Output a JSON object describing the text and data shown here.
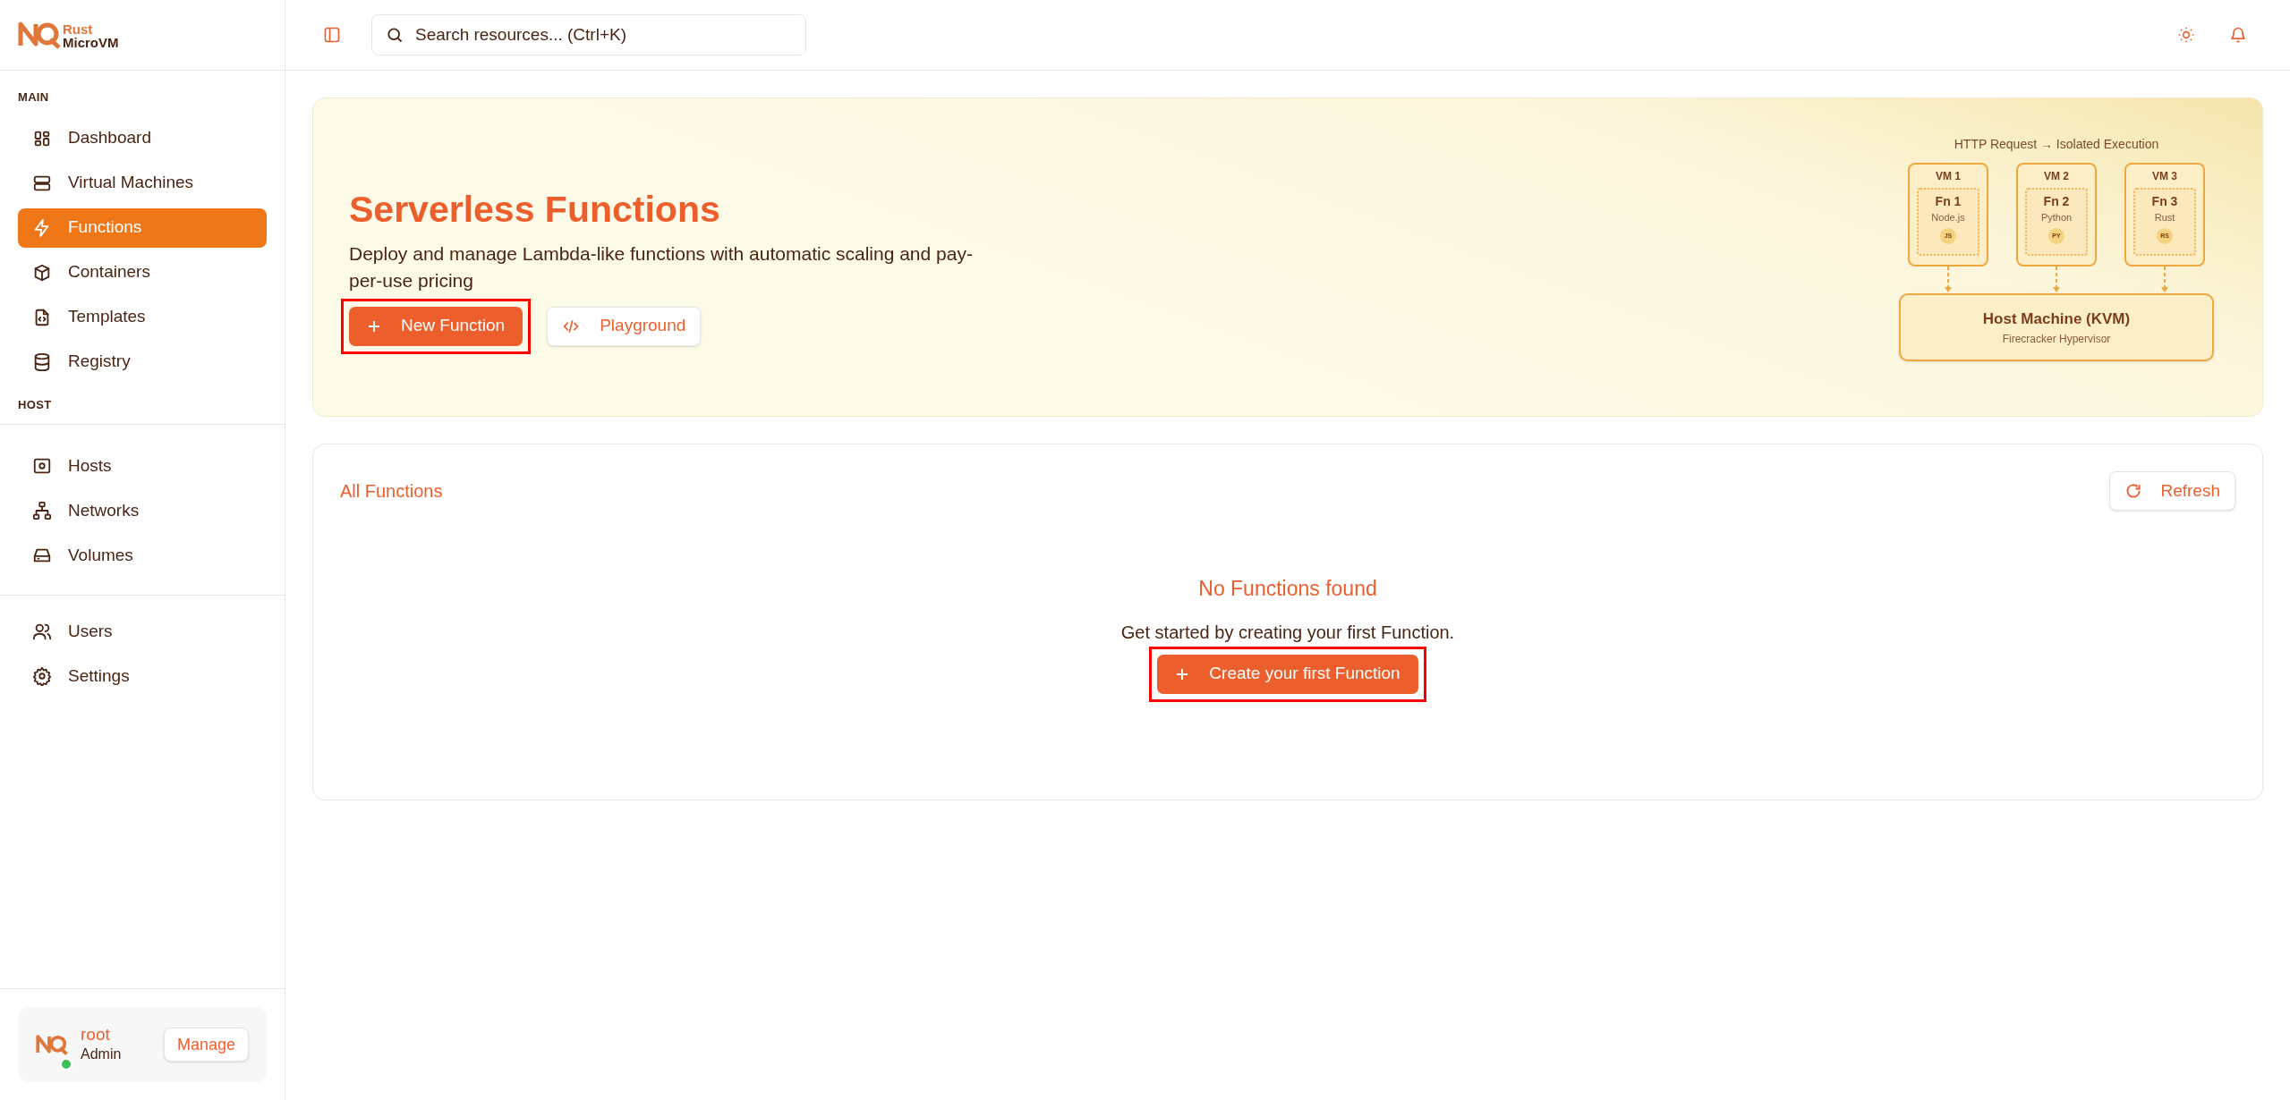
{
  "brand": {
    "line_1": "Rust",
    "line_2": "MicroVM"
  },
  "sidebar": {
    "sections": [
      {
        "title": "MAIN",
        "items": [
          {
            "label": "Dashboard",
            "selected": false
          },
          {
            "label": "Virtual Machines",
            "selected": false
          },
          {
            "label": "Functions",
            "selected": true
          },
          {
            "label": "Containers",
            "selected": false
          },
          {
            "label": "Templates",
            "selected": false
          },
          {
            "label": "Registry",
            "selected": false
          }
        ]
      },
      {
        "title": "HOST",
        "items": [
          {
            "label": "Hosts",
            "selected": false
          },
          {
            "label": "Networks",
            "selected": false
          },
          {
            "label": "Volumes",
            "selected": false
          }
        ]
      },
      {
        "items": [
          {
            "label": "Users",
            "selected": false
          },
          {
            "label": "Settings",
            "selected": false
          }
        ]
      }
    ],
    "user": {
      "name": "root",
      "role": "Admin",
      "online": true,
      "button": "Manage"
    }
  },
  "header": {
    "search": {
      "placeholder": "Search resources... (Ctrl+K)"
    }
  },
  "hero": {
    "title": "Serverless Functions",
    "description": "Deploy and manage Lambda-like functions with automatic scaling and pay-per-use pricing",
    "buttons": [
      {
        "label": "New Function",
        "kind": "primary",
        "highlighted": true
      },
      {
        "label": "Playground",
        "kind": "secondary",
        "highlighted": false
      }
    ],
    "diagram": {
      "caption": "HTTP Request → Isolated Execution",
      "vms": [
        {
          "vm": "VM 1",
          "fn": "Fn 1",
          "runtime": "Node.js",
          "badge": "JS"
        },
        {
          "vm": "VM 2",
          "fn": "Fn 2",
          "runtime": "Python",
          "badge": "PY"
        },
        {
          "vm": "VM 3",
          "fn": "Fn 3",
          "runtime": "Rust",
          "badge": "RS"
        }
      ],
      "host": {
        "title": "Host Machine (KVM)",
        "subtitle": "Firecracker Hypervisor"
      }
    }
  },
  "functions_panel": {
    "title": "All Functions",
    "refresh_button": "Refresh",
    "empty_state": {
      "title": "No Functions found",
      "message": "Get started by creating your first Function.",
      "button": {
        "label": "Create your first Function",
        "highlighted": true
      }
    }
  }
}
